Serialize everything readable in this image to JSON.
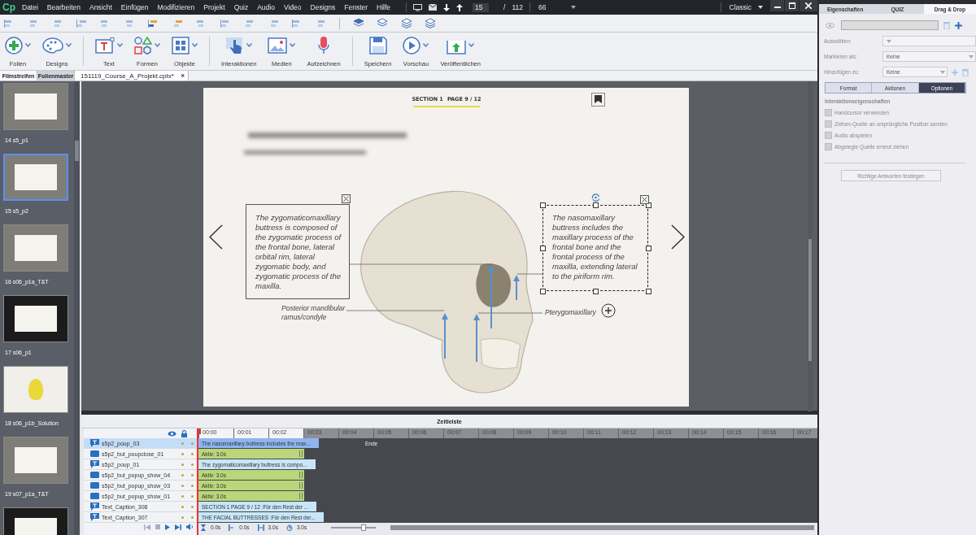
{
  "menu_bar": {
    "logo": "Cp",
    "items": [
      "Datei",
      "Bearbeiten",
      "Ansicht",
      "Einfügen",
      "Modifizieren",
      "Projekt",
      "Quiz",
      "Audio",
      "Video",
      "Designs",
      "Fenster",
      "Hilfe"
    ],
    "page_field": {
      "value": "15"
    },
    "page_separator": "/",
    "page_total": "112",
    "zoom": {
      "value": "66"
    },
    "workspace": {
      "value": "Classic"
    }
  },
  "toolbar": {
    "groups": [
      [
        {
          "label": "Folien",
          "kind": "slides",
          "dropdown": true
        },
        {
          "label": "Designs",
          "kind": "designs",
          "dropdown": true
        }
      ],
      [
        {
          "label": "Text",
          "kind": "text",
          "dropdown": true
        },
        {
          "label": "Formen",
          "kind": "shapes",
          "dropdown": true
        },
        {
          "label": "Objekte",
          "kind": "objects",
          "dropdown": true
        }
      ],
      [
        {
          "label": "Interaktionen",
          "kind": "interactions",
          "dropdown": true
        },
        {
          "label": "Medien",
          "kind": "media",
          "dropdown": true
        },
        {
          "label": "Aufzeichnen",
          "kind": "record",
          "dropdown": false
        }
      ],
      [
        {
          "label": "Speichern",
          "kind": "save",
          "dropdown": false
        },
        {
          "label": "Vorschau",
          "kind": "preview",
          "dropdown": true
        },
        {
          "label": "Veröffentlichen",
          "kind": "publish",
          "dropdown": true
        }
      ]
    ]
  },
  "panel_tabs": [
    {
      "label": "Filmstreifen",
      "selected": true
    },
    {
      "label": "Folienmaster",
      "selected": false
    }
  ],
  "document_tab": {
    "label": "151119_Course_A_Projekt.cptx*",
    "close": "×"
  },
  "filmstrip": {
    "slides": [
      {
        "label": "14 s5_p1",
        "kind": "popup",
        "selected": false
      },
      {
        "label": "15 s5_p2",
        "kind": "popup",
        "selected": true
      },
      {
        "label": "16 s06_p1a_T&T",
        "kind": "popup",
        "selected": false
      },
      {
        "label": "17 s06_p1",
        "kind": "dark",
        "selected": false
      },
      {
        "label": "18 s06_p1b_Solution",
        "kind": "diagram",
        "selected": false
      },
      {
        "label": "19 s07_p1a_T&T",
        "kind": "popup",
        "selected": false
      },
      {
        "kind": "dark",
        "selected": false
      }
    ]
  },
  "slide": {
    "section": "SECTION 1",
    "page": "PAGE 9 / 12",
    "popups": [
      {
        "text": "The zygomaticomaxillary buttress is composed of the zygomatic process of the frontal bone, lateral orbital rim, lateral zygomatic body, and zygomatic process of the maxilla.",
        "selected": false
      },
      {
        "text": "The nasomaxillary buttress includes the maxillary process of the frontal bone and the frontal process of the maxilla, extending lateral to the piriform rim.",
        "selected": true
      }
    ],
    "labels": [
      "Posterior mandibular ramus/condyle",
      "Pterygomaxillary"
    ]
  },
  "timeline": {
    "title": "Zeitleiste",
    "ruler": [
      "00:00",
      "00:01",
      "00:02",
      "00:03",
      "00:04",
      "00:05",
      "00:06",
      "00:07",
      "00:08",
      "00:09",
      "00:10",
      "00:11",
      "00:12",
      "00:13",
      "00:14",
      "00:15",
      "00:16",
      "00:17"
    ],
    "end_label": "Ende",
    "rows": [
      {
        "name": "s5p2_poup_03",
        "kind": "caption",
        "bar": "The nasomaxillary buttress includes the max...",
        "selected": true
      },
      {
        "name": "s5p2_but_poupclose_01",
        "kind": "button",
        "bar": "Aktiv: 3.0s",
        "selected": false
      },
      {
        "name": "s5p2_poup_01",
        "kind": "caption",
        "bar": "The zygomaticomaxillary buttress is compo...",
        "selected": false
      },
      {
        "name": "s5p2_but_popup_show_04",
        "kind": "button",
        "bar": "Aktiv: 3.0s",
        "selected": false
      },
      {
        "name": "s5p2_but_popup_show_03",
        "kind": "button",
        "bar": "Aktiv: 3.0s",
        "selected": false
      },
      {
        "name": "s5p2_but_popup_show_01",
        "kind": "button",
        "bar": "Aktiv: 3.0s",
        "selected": false
      },
      {
        "name": "Text_Caption_308",
        "kind": "caption",
        "bar": "SECTION 1    PAGE 9 / 12 :Für den Rest der ...",
        "selected": false
      },
      {
        "name": "Text_Caption_307",
        "kind": "caption",
        "bar": "THE FACIAL BUTTRESSES :Für den Rest der...",
        "selected": false
      }
    ],
    "readouts": [
      "0.0s",
      "0.0s",
      "3.0s",
      "3.0s"
    ],
    "zoom_slider": {
      "level": 0.75
    }
  },
  "properties": {
    "tabs": [
      {
        "label": "Eigenschaften",
        "selected": false
      },
      {
        "label": "QUIZ",
        "selected": false
      },
      {
        "label": "Drag & Drop",
        "selected": true
      }
    ],
    "disabled": true,
    "fields": [
      {
        "label": "Auswählen:",
        "kind": "select"
      },
      {
        "label": "Markieren als:",
        "value": "Keine",
        "kind": "select"
      },
      {
        "label": "Hinzufügen zu:",
        "value": "Keine",
        "kind": "select-add"
      }
    ],
    "subtabs": [
      {
        "label": "Format",
        "selected": false
      },
      {
        "label": "Aktionen",
        "selected": false
      },
      {
        "label": "Optionen",
        "selected": true
      }
    ],
    "section_title": "Interaktionseigenschaften",
    "options": [
      {
        "label": "Handcursor verwenden",
        "checked": false
      },
      {
        "label": "Ziehen-Quelle an ursprüngliche Position senden",
        "checked": false
      },
      {
        "label": "Audio abspielen",
        "checked": false
      },
      {
        "label": "Abgelegte Quelle erneut ziehen",
        "checked": false
      }
    ],
    "button": {
      "label": "Richtige Antworten festlegen"
    }
  }
}
